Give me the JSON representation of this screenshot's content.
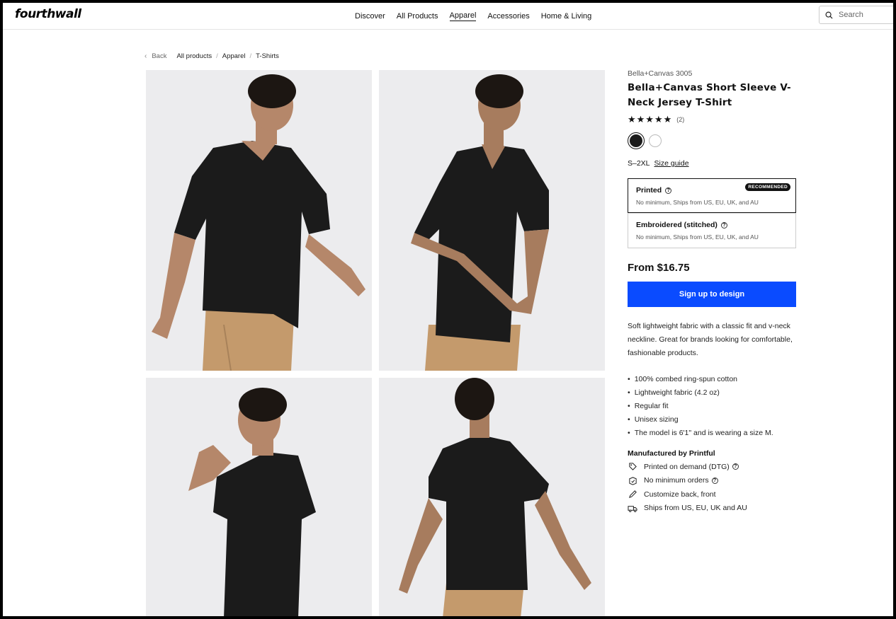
{
  "header": {
    "logo": "fourthwall",
    "nav": [
      "Discover",
      "All Products",
      "Apparel",
      "Accessories",
      "Home & Living"
    ],
    "active_nav": "Apparel",
    "search_placeholder": "Search"
  },
  "breadcrumb": {
    "back": "Back",
    "items": [
      "All products",
      "Apparel",
      "T-Shirts"
    ]
  },
  "product": {
    "brand": "Bella+Canvas 3005",
    "title": "Bella+Canvas Short Sleeve V-Neck Jersey T-Shirt",
    "stars": "★★★★★",
    "rating": 5,
    "review_count": "(2)",
    "colors": [
      "#1b1b1b",
      "#ffffff"
    ],
    "selected_color": "#1b1b1b",
    "size_range": "S–2XL",
    "size_guide": "Size guide",
    "options": [
      {
        "name": "Printed",
        "sub": "No minimum, Ships from US, EU, UK, and AU",
        "badge": "RECOMMENDED",
        "selected": true
      },
      {
        "name": "Embroidered (stitched)",
        "sub": "No minimum, Ships from US, EU, UK, and AU",
        "badge": "",
        "selected": false
      }
    ],
    "price": "From $16.75",
    "cta": "Sign up to design",
    "description": "Soft lightweight fabric with a classic fit and v-neck neckline. Great for brands looking for comfortable, fashionable products.",
    "bullets": [
      "100% combed ring-spun cotton",
      "Lightweight fabric (4.2 oz)",
      "Regular fit",
      "Unisex sizing",
      "The model is 6'1\" and is wearing a size M."
    ],
    "manufacturer": "Manufactured by Printful",
    "features": [
      {
        "icon": "print-tag-icon",
        "text": "Printed on demand (DTG)",
        "help": true
      },
      {
        "icon": "package-icon",
        "text": "No minimum orders",
        "help": true
      },
      {
        "icon": "pencil-icon",
        "text": "Customize back, front",
        "help": false
      },
      {
        "icon": "truck-icon",
        "text": "Ships from US, EU, UK and AU",
        "help": false
      }
    ]
  },
  "colors": {
    "accent": "#0a4bff",
    "shirt": "#1b1b1b",
    "pants": "#c49a6c"
  }
}
